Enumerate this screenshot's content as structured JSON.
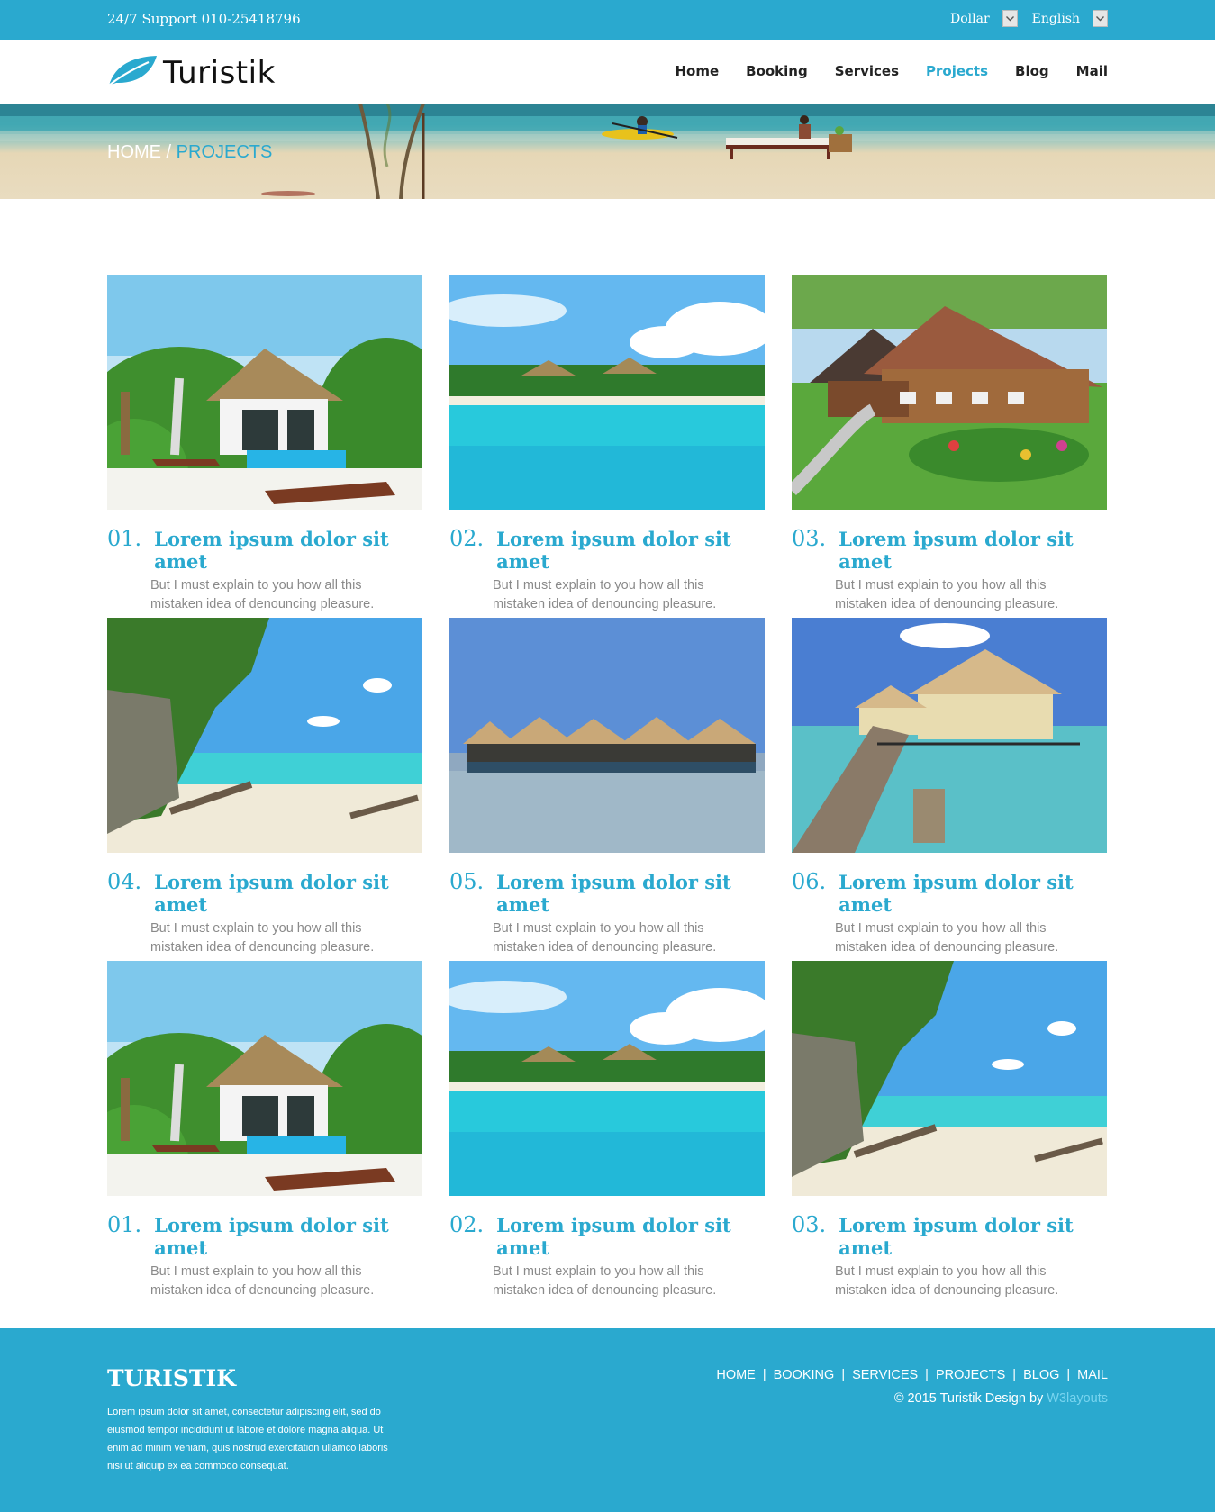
{
  "topbar": {
    "support": "24/7 Support 010-25418796",
    "currency": "Dollar",
    "language": "English"
  },
  "header": {
    "logo_text": "Turistik",
    "nav": [
      {
        "label": "Home",
        "active": false
      },
      {
        "label": "Booking",
        "active": false
      },
      {
        "label": "Services",
        "active": false
      },
      {
        "label": "Projects",
        "active": true
      },
      {
        "label": "Blog",
        "active": false
      },
      {
        "label": "Mail",
        "active": false
      }
    ]
  },
  "banner": {
    "crumb_home": "HOME",
    "crumb_sep": " / ",
    "crumb_current": "PROJECTS"
  },
  "projects": [
    {
      "num": "01.",
      "title": "Lorem ipsum dolor sit amet",
      "desc_1": "But I must explain to you how all this",
      "desc_2": "mistaken idea of denouncing pleasure.",
      "scene": "villa-pool"
    },
    {
      "num": "02.",
      "title": "Lorem ipsum dolor sit amet",
      "desc_1": "But I must explain to you how all this",
      "desc_2": "mistaken idea of denouncing pleasure.",
      "scene": "lagoon"
    },
    {
      "num": "03.",
      "title": "Lorem ipsum dolor sit amet",
      "desc_1": "But I must explain to you how all this",
      "desc_2": "mistaken idea of denouncing pleasure.",
      "scene": "chalet"
    },
    {
      "num": "04.",
      "title": "Lorem ipsum dolor sit amet",
      "desc_1": "But I must explain to you how all this",
      "desc_2": "mistaken idea of denouncing pleasure.",
      "scene": "rock-beach"
    },
    {
      "num": "05.",
      "title": "Lorem ipsum dolor sit amet",
      "desc_1": "But I must explain to you how all this",
      "desc_2": "mistaken idea of denouncing pleasure.",
      "scene": "water-huts"
    },
    {
      "num": "06.",
      "title": "Lorem ipsum dolor sit amet",
      "desc_1": "But I must explain to you how all this",
      "desc_2": "mistaken idea of denouncing pleasure.",
      "scene": "pier-bungalows"
    },
    {
      "num": "01.",
      "title": "Lorem ipsum dolor sit amet",
      "desc_1": "But I must explain to you how all this",
      "desc_2": "mistaken idea of denouncing pleasure.",
      "scene": "villa-pool"
    },
    {
      "num": "02.",
      "title": "Lorem ipsum dolor sit amet",
      "desc_1": "But I must explain to you how all this",
      "desc_2": "mistaken idea of denouncing pleasure.",
      "scene": "lagoon"
    },
    {
      "num": "03.",
      "title": "Lorem ipsum dolor sit amet",
      "desc_1": "But I must explain to you how all this",
      "desc_2": "mistaken idea of denouncing pleasure.",
      "scene": "rock-beach"
    }
  ],
  "footer": {
    "brand": "TURISTIK",
    "about": "Lorem ipsum dolor sit amet, consectetur adipiscing elit, sed do eiusmod tempor incididunt ut labore et dolore magna aliqua. Ut enim ad minim veniam, quis nostrud exercitation ullamco laboris nisi ut aliquip ex ea commodo consequat.",
    "links": [
      "HOME",
      "BOOKING",
      "SERVICES",
      "PROJECTS",
      "BLOG",
      "MAIL"
    ],
    "separator": "|",
    "copyright": "© 2015 Turistik Design by ",
    "credit": "W3layouts"
  },
  "colors": {
    "accent": "#2aa9cf",
    "text_dark": "#222222",
    "text_muted": "#8a8a8a"
  }
}
